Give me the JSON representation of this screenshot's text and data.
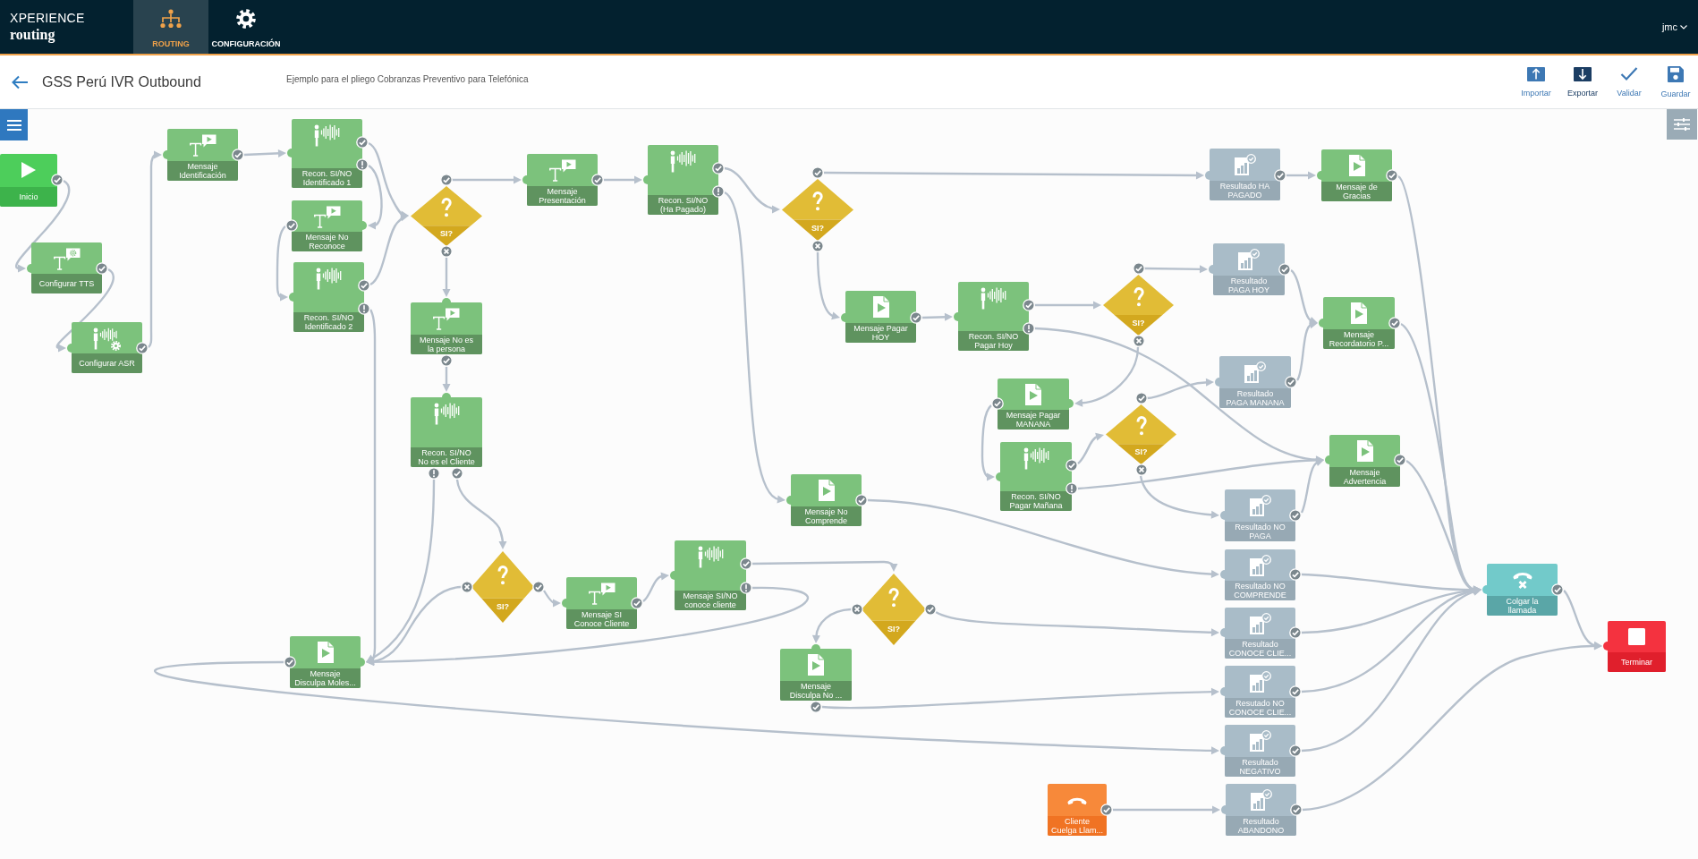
{
  "app": {
    "brand": "XPERIENCE",
    "product": "routing",
    "user": "jmc"
  },
  "nav_tabs": [
    {
      "kind": "routing",
      "label": "ROUTING",
      "selected": true
    },
    {
      "kind": "settings",
      "label": "CONFIGURACIÓN",
      "selected": false
    }
  ],
  "flow": {
    "title": "GSS Perú IVR Outbound",
    "description": "Ejemplo para el pliego Cobranzas Preventivo para Telefónica"
  },
  "toolbar": [
    {
      "kind": "import",
      "label": "Importar",
      "highlighted": false
    },
    {
      "kind": "export",
      "label": "Exportar",
      "highlighted": true
    },
    {
      "kind": "validate",
      "label": "Validar",
      "highlighted": false
    },
    {
      "kind": "save",
      "label": "Guardar",
      "highlighted": false
    }
  ],
  "canvas": {
    "nodes": [
      {
        "kind": "start",
        "label": "Inicio",
        "ports": [
          {
            "kind": "ok"
          }
        ]
      },
      {
        "kind": "tts_config",
        "label": "Configurar TTS",
        "ports": [
          {
            "kind": "ok"
          }
        ]
      },
      {
        "kind": "asr_config",
        "label": "Configurar ASR",
        "ports": [
          {
            "kind": "ok"
          }
        ]
      },
      {
        "kind": "tts_message",
        "label": "Mensaje\nIdentificación",
        "ports": [
          {
            "kind": "ok"
          }
        ]
      },
      {
        "kind": "recognize",
        "label": "Recon. SI/NO\nIdentificado 1",
        "ports": [
          {
            "kind": "ok"
          },
          {
            "kind": "error"
          }
        ]
      },
      {
        "kind": "tts_message",
        "label": "Mensaje No\nReconoce",
        "ports": [
          {
            "kind": "ok"
          }
        ]
      },
      {
        "kind": "recognize",
        "label": "Recon. SI/NO\nIdentificado 2",
        "ports": [
          {
            "kind": "ok"
          },
          {
            "kind": "error"
          }
        ]
      },
      {
        "kind": "decision",
        "label": "SI?",
        "ports": [
          {
            "kind": "ok"
          },
          {
            "kind": "no"
          }
        ]
      },
      {
        "kind": "tts_message",
        "label": "Mensaje No es\nla persona",
        "ports": [
          {
            "kind": "ok"
          }
        ]
      },
      {
        "kind": "recognize",
        "label": "Recon. SI/NO\nNo es el Cliente",
        "ports": [
          {
            "kind": "error"
          },
          {
            "kind": "ok"
          }
        ]
      },
      {
        "kind": "tts_message",
        "label": "Mensaje\nPresentación",
        "ports": [
          {
            "kind": "ok"
          }
        ]
      },
      {
        "kind": "recognize",
        "label": "Recon. SI/NO\n(Ha Pagado)",
        "ports": [
          {
            "kind": "ok"
          },
          {
            "kind": "error"
          }
        ]
      },
      {
        "kind": "decision",
        "label": "SI?",
        "ports": [
          {
            "kind": "ok"
          },
          {
            "kind": "no"
          }
        ]
      },
      {
        "kind": "audio_message",
        "label": "Mensaje Pagar\nHOY",
        "ports": [
          {
            "kind": "ok"
          }
        ]
      },
      {
        "kind": "recognize",
        "label": "Recon. SI/NO\nPagar Hoy",
        "ports": [
          {
            "kind": "ok"
          },
          {
            "kind": "error"
          }
        ]
      },
      {
        "kind": "decision",
        "label": "SI?",
        "ports": [
          {
            "kind": "ok"
          },
          {
            "kind": "no"
          }
        ]
      },
      {
        "kind": "audio_message",
        "label": "Mensaje Pagar\nMANANA",
        "ports": [
          {
            "kind": "ok"
          }
        ]
      },
      {
        "kind": "recognize",
        "label": "Recon. SI/NO\nPagar Mañana",
        "ports": [
          {
            "kind": "ok"
          },
          {
            "kind": "error"
          }
        ]
      },
      {
        "kind": "decision",
        "label": "SI?",
        "ports": [
          {
            "kind": "ok"
          },
          {
            "kind": "no"
          }
        ]
      },
      {
        "kind": "audio_message",
        "label": "Mensaje No\nComprende",
        "ports": [
          {
            "kind": "ok"
          }
        ]
      },
      {
        "kind": "result",
        "label": "Resultado HA\nPAGADO",
        "ports": [
          {
            "kind": "ok"
          }
        ]
      },
      {
        "kind": "audio_message",
        "label": "Mensaje de\nGracias",
        "ports": [
          {
            "kind": "ok"
          }
        ]
      },
      {
        "kind": "result",
        "label": "Resultado\nPAGA HOY",
        "ports": [
          {
            "kind": "ok"
          }
        ]
      },
      {
        "kind": "audio_message",
        "label": "Mensaje\nRecordatorio P...",
        "ports": [
          {
            "kind": "ok"
          }
        ]
      },
      {
        "kind": "result",
        "label": "Resultado\nPAGA MANANA",
        "ports": [
          {
            "kind": "ok"
          }
        ]
      },
      {
        "kind": "audio_message",
        "label": "Mensaje\nAdvertencia",
        "ports": [
          {
            "kind": "ok"
          }
        ]
      },
      {
        "kind": "result",
        "label": "Resultado NO\nPAGA",
        "ports": [
          {
            "kind": "ok"
          }
        ]
      },
      {
        "kind": "result",
        "label": "Resultado NO\nCOMPRENDE",
        "ports": [
          {
            "kind": "ok"
          }
        ]
      },
      {
        "kind": "result",
        "label": "Resultado\nCONOCE CLIE...",
        "ports": [
          {
            "kind": "ok"
          }
        ]
      },
      {
        "kind": "result",
        "label": "Resutado NO\nCONOCE CLIE...",
        "ports": [
          {
            "kind": "ok"
          }
        ]
      },
      {
        "kind": "result",
        "label": "Resultado\nNEGATIVO",
        "ports": [
          {
            "kind": "ok"
          }
        ]
      },
      {
        "kind": "caller_hangup",
        "label": "Cliente\nCuelga Llam...",
        "ports": [
          {
            "kind": "ok"
          }
        ]
      },
      {
        "kind": "result",
        "label": "Resultado\nABANDONO",
        "ports": [
          {
            "kind": "ok"
          }
        ]
      },
      {
        "kind": "hangup",
        "label": "Colgar la\nllamada",
        "ports": [
          {
            "kind": "ok"
          }
        ]
      },
      {
        "kind": "end",
        "label": "Terminar"
      },
      {
        "kind": "decision",
        "label": "SI?",
        "ports": [
          {
            "kind": "no"
          },
          {
            "kind": "ok"
          }
        ]
      },
      {
        "kind": "tts_message",
        "label": "Mensaje SI\nConoce Cliente",
        "ports": [
          {
            "kind": "ok"
          }
        ]
      },
      {
        "kind": "recognize",
        "label": "Mensaje SI/NO\nconoce cliente",
        "ports": [
          {
            "kind": "ok"
          },
          {
            "kind": "error"
          }
        ]
      },
      {
        "kind": "decision",
        "label": "SI?",
        "ports": [
          {
            "kind": "no"
          },
          {
            "kind": "ok"
          }
        ]
      },
      {
        "kind": "audio_message",
        "label": "Mensaje\nDisculpa Moles...",
        "ports": [
          {
            "kind": "ok"
          }
        ]
      },
      {
        "kind": "audio_message",
        "label": "Mensaje\nDisculpa No ...",
        "ports": [
          {
            "kind": "ok"
          }
        ]
      }
    ]
  }
}
